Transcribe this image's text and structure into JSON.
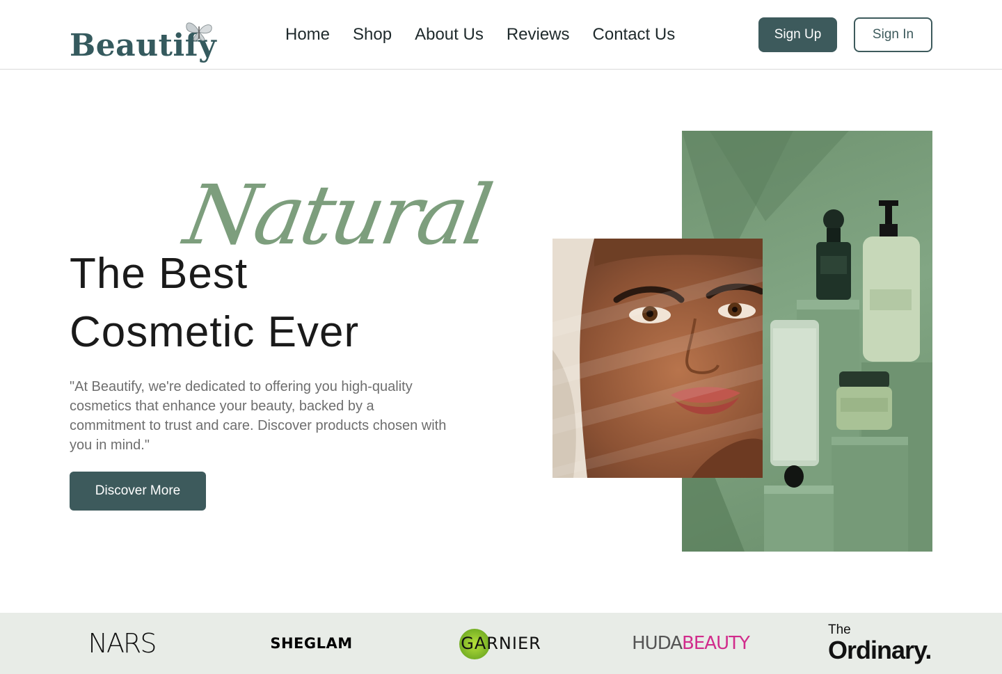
{
  "header": {
    "logo_text": "Beautify",
    "nav": [
      "Home",
      "Shop",
      "About Us",
      "Reviews",
      "Contact Us"
    ],
    "signup_label": "Sign Up",
    "signin_label": "Sign In"
  },
  "hero": {
    "script_word": "Natural",
    "title_line1": "The Best",
    "title_line2": "Cosmetic Ever",
    "description": "\"At Beautify, we're dedicated to offering you high-quality cosmetics that enhance your beauty, backed by a commitment to trust and care. Discover products chosen with you in mind.\"",
    "cta_label": "Discover More"
  },
  "brands": {
    "nars": "NARS",
    "sheglam": "SHEGLAM",
    "garnier": "GARNIER",
    "huda_part1": "HUDA",
    "huda_part2": "BEAUTY",
    "ordinary_the": "The",
    "ordinary_main": "Ordinary."
  },
  "colors": {
    "primary": "#3d5a5c",
    "accent_green": "#7d9e7d",
    "brand_strip_bg": "#e8ece7",
    "huda_pink": "#d12c8c"
  },
  "icons": {
    "logo_decoration": "butterfly-icon"
  }
}
